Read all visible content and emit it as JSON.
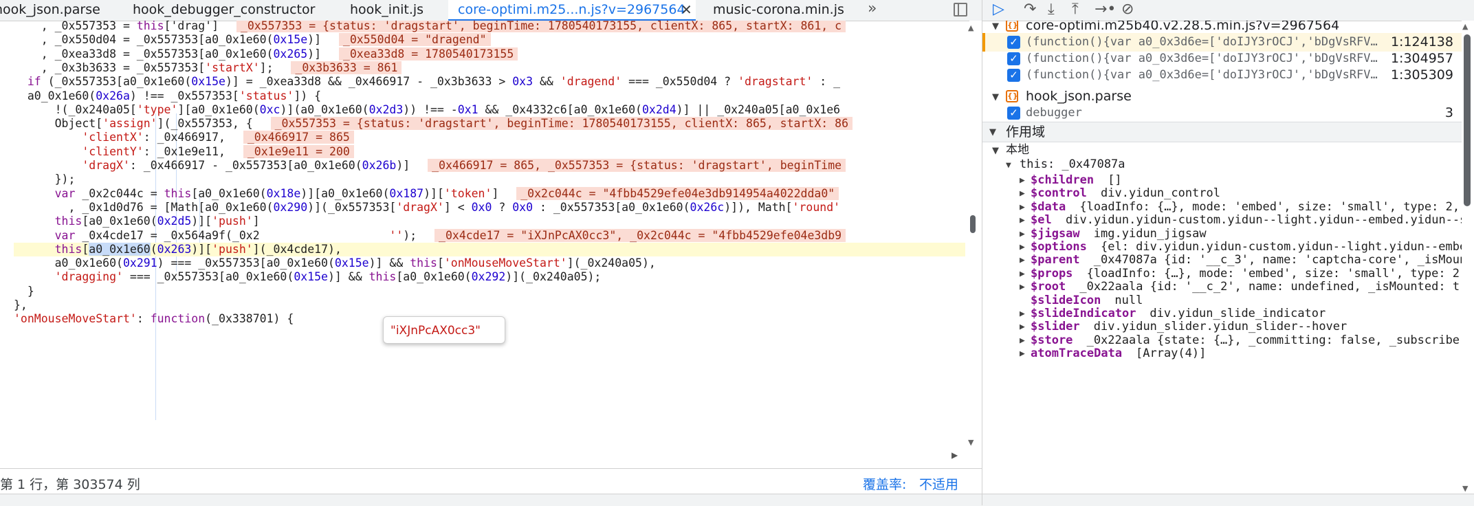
{
  "tabs": [
    {
      "label": "hook_json.parse",
      "active": false
    },
    {
      "label": "hook_debugger_constructor",
      "active": false
    },
    {
      "label": "hook_init.js",
      "active": false
    },
    {
      "label": "core-optimi.m25...n.js?v=2967564",
      "active": true
    },
    {
      "label": "music-corona.min.js",
      "active": false
    }
  ],
  "tab_close_glyph": "✕",
  "tab_more_glyph": "»",
  "code_lines": [
    {
      "segs": [
        [
          "p",
          "    , _0x557353 = "
        ],
        [
          "k",
          "this"
        ],
        [
          "p",
          "['drag']  "
        ],
        [
          "i",
          "_0x557353 = {status: 'dragstart', beginTime: 1780540173155, clientX: 865, startX: 861, c"
        ]
      ]
    },
    {
      "segs": [
        [
          "p",
          "    , _0x550d04 = _0x557353[a0_0x1e60("
        ],
        [
          "n",
          "0x15e"
        ],
        [
          "p",
          ")]  "
        ],
        [
          "i",
          "_0x550d04 = \"dragend\""
        ]
      ]
    },
    {
      "segs": [
        [
          "p",
          "    , _0xea33d8 = _0x557353[a0_0x1e60("
        ],
        [
          "n",
          "0x265"
        ],
        [
          "p",
          ")]  "
        ],
        [
          "i",
          "_0xea33d8 = 1780540173155"
        ]
      ]
    },
    {
      "segs": [
        [
          "p",
          "    , _0x3b3633 = _0x557353["
        ],
        [
          "s",
          "'startX'"
        ],
        [
          "p",
          "];  "
        ],
        [
          "i",
          "_0x3b3633 = 861"
        ]
      ]
    },
    {
      "segs": [
        [
          "p",
          "  "
        ],
        [
          "k",
          "if"
        ],
        [
          "p",
          " (_0x557353[a0_0x1e60("
        ],
        [
          "n",
          "0x15e"
        ],
        [
          "p",
          ")] = _0xea33d8 && _0x466917 - _0x3b3633 > "
        ],
        [
          "n",
          "0x3"
        ],
        [
          "p",
          " && "
        ],
        [
          "s",
          "'dragend'"
        ],
        [
          "p",
          " === _0x550d04 ? "
        ],
        [
          "s",
          "'dragstart'"
        ],
        [
          "p",
          " : _"
        ]
      ]
    },
    {
      "segs": [
        [
          "p",
          "  a0_0x1e60("
        ],
        [
          "n",
          "0x26a"
        ],
        [
          "p",
          ") !== _0x557353["
        ],
        [
          "s",
          "'status'"
        ],
        [
          "p",
          "]) {"
        ]
      ]
    },
    {
      "segs": [
        [
          "p",
          "      !(_0x240a05["
        ],
        [
          "s",
          "'type'"
        ],
        [
          "p",
          "][a0_0x1e60("
        ],
        [
          "n",
          "0xc"
        ],
        [
          "p",
          ")](a0_0x1e60("
        ],
        [
          "n",
          "0x2d3"
        ],
        [
          "p",
          ")) !== -"
        ],
        [
          "n",
          "0x1"
        ],
        [
          "p",
          " && _0x4332c6[a0_0x1e60("
        ],
        [
          "n",
          "0x2d4"
        ],
        [
          "p",
          ")] || _0x240a05[a0_0x1e6"
        ]
      ]
    },
    {
      "segs": [
        [
          "p",
          "      Object["
        ],
        [
          "s",
          "'assign'"
        ],
        [
          "p",
          "](_0x557353, {  "
        ],
        [
          "i",
          "_0x557353 = {status: 'dragstart', beginTime: 1780540173155, clientX: 865, startX: 86"
        ]
      ]
    },
    {
      "segs": [
        [
          "p",
          "          "
        ],
        [
          "s",
          "'clientX'"
        ],
        [
          "p",
          ": _0x466917,  "
        ],
        [
          "i",
          "_0x466917 = 865"
        ]
      ]
    },
    {
      "segs": [
        [
          "p",
          "          "
        ],
        [
          "s",
          "'clientY'"
        ],
        [
          "p",
          ": _0x1e9e11,  "
        ],
        [
          "i",
          "_0x1e9e11 = 200"
        ]
      ]
    },
    {
      "segs": [
        [
          "p",
          "          "
        ],
        [
          "s",
          "'dragX'"
        ],
        [
          "p",
          ": _0x466917 - _0x557353[a0_0x1e60("
        ],
        [
          "n",
          "0x26b"
        ],
        [
          "p",
          ")]  "
        ],
        [
          "i",
          "_0x466917 = 865, _0x557353 = {status: 'dragstart', beginTime"
        ]
      ]
    },
    {
      "segs": [
        [
          "p",
          "      });"
        ]
      ]
    },
    {
      "segs": [
        [
          "p",
          "      "
        ],
        [
          "k",
          "var"
        ],
        [
          "p",
          " _0x2c044c = "
        ],
        [
          "k",
          "this"
        ],
        [
          "p",
          "[a0_0x1e60("
        ],
        [
          "n",
          "0x18e"
        ],
        [
          "p",
          ")][a0_0x1e60("
        ],
        [
          "n",
          "0x187"
        ],
        [
          "p",
          ")]["
        ],
        [
          "s",
          "'token'"
        ],
        [
          "p",
          "]  "
        ],
        [
          "i",
          "_0x2c044c = \"4fbb4529efe04e3db914954a4022dda0\""
        ]
      ]
    },
    {
      "segs": [
        [
          "p",
          "        , _0x1d0d76 = [Math[a0_0x1e60("
        ],
        [
          "n",
          "0x290"
        ],
        [
          "p",
          ")](_0x557353["
        ],
        [
          "s",
          "'dragX'"
        ],
        [
          "p",
          "] < "
        ],
        [
          "n",
          "0x0"
        ],
        [
          "p",
          " ? "
        ],
        [
          "n",
          "0x0"
        ],
        [
          "p",
          " : _0x557353[a0_0x1e60("
        ],
        [
          "n",
          "0x26c"
        ],
        [
          "p",
          ")]), Math["
        ],
        [
          "s",
          "'round'"
        ]
      ]
    },
    {
      "segs": [
        [
          "p",
          "      "
        ],
        [
          "k",
          "this"
        ],
        [
          "p",
          "[a0_0x1e60("
        ],
        [
          "n",
          "0x2d5"
        ],
        [
          "p",
          ")]["
        ],
        [
          "s",
          "'push'"
        ],
        [
          "p",
          "]"
        ]
      ]
    },
    {
      "segs": [
        [
          "p",
          "      "
        ],
        [
          "k",
          "var"
        ],
        [
          "p",
          " _0x4cde17 = _0x564a9f(_0x2                   "
        ],
        [
          "s",
          "''"
        ],
        [
          "p",
          ");  "
        ],
        [
          "i",
          "_0x4cde17 = \"iXJnPcAX0cc3\", _0x2c044c = \"4fbb4529efe04e3db9"
        ]
      ]
    },
    {
      "segs": [
        [
          "p",
          "      "
        ],
        [
          "k",
          "this"
        ],
        [
          "p",
          "["
        ],
        [
          "sel",
          "a0_0x1e60"
        ],
        [
          "p",
          "("
        ],
        [
          "n",
          "0x263"
        ],
        [
          "p",
          ")]["
        ],
        [
          "s",
          "'push'"
        ],
        [
          "p",
          "](_0x4cde17),"
        ]
      ]
    },
    {
      "segs": [
        [
          "p",
          "      a0_0x1e60("
        ],
        [
          "n",
          "0x291"
        ],
        [
          "p",
          ") === _0x557353[a0_0x1e60("
        ],
        [
          "n",
          "0x15e"
        ],
        [
          "p",
          ")] && "
        ],
        [
          "k",
          "this"
        ],
        [
          "p",
          "["
        ],
        [
          "s",
          "'onMouseMoveStart'"
        ],
        [
          "p",
          "](_0x240a05),"
        ]
      ]
    },
    {
      "segs": [
        [
          "p",
          "      "
        ],
        [
          "s",
          "'dragging'"
        ],
        [
          "p",
          " === _0x557353[a0_0x1e60("
        ],
        [
          "n",
          "0x15e"
        ],
        [
          "p",
          ")] && "
        ],
        [
          "k",
          "this"
        ],
        [
          "p",
          "[a0_0x1e60("
        ],
        [
          "n",
          "0x292"
        ],
        [
          "p",
          ")](_0x240a05);"
        ]
      ]
    },
    {
      "segs": [
        [
          "p",
          "  }"
        ]
      ]
    },
    {
      "segs": [
        [
          "p",
          "},"
        ]
      ]
    },
    {
      "segs": [
        [
          "s",
          "'onMouseMoveStart'"
        ],
        [
          "p",
          ": "
        ],
        [
          "k",
          "function"
        ],
        [
          "p",
          "(_0x338701) {"
        ]
      ]
    },
    {
      "segs": [
        [
          "p",
          ""
        ]
      ]
    }
  ],
  "hover_popup": "\"iXJnPcAX0cc3\"",
  "status": {
    "position": "第 1 行，第 303574 列",
    "coverage_label": "覆盖率:",
    "coverage_value": "不适用"
  },
  "breakpoints": {
    "file1": "core-optimi.m25b40.v2.28.5.min.js?v=2967564",
    "file1_items": [
      {
        "code": "(function(){var a0_0x3d6e=['doIJY3rOCJ','bDgVsRFV…",
        "loc": "1:124138",
        "active": true
      },
      {
        "code": "(function(){var a0_0x3d6e=['doIJY3rOCJ','bDgVsRFV…",
        "loc": "1:304957",
        "active": false
      },
      {
        "code": "(function(){var a0_0x3d6e=['doIJY3rOCJ','bDgVsRFV…",
        "loc": "1:305309",
        "active": false
      }
    ],
    "file2": "hook_json.parse",
    "file2_items": [
      {
        "code": "debugger",
        "loc": "3",
        "active": false
      }
    ]
  },
  "scope": {
    "section_title": "作用域",
    "local_label": "本地",
    "this_label": "this: _0x47087a",
    "props": [
      {
        "name": "$children",
        "value": "[]",
        "expandable": true
      },
      {
        "name": "$control",
        "value": "div.yidun_control",
        "expandable": true
      },
      {
        "name": "$data",
        "value": "{loadInfo: {…}, mode: 'embed', size: 'small', type: 2,",
        "expandable": true
      },
      {
        "name": "$el",
        "value": "div.yidun.yidun-custom.yidun--light.yidun--embed.yidun--si",
        "expandable": true
      },
      {
        "name": "$jigsaw",
        "value": "img.yidun_jigsaw",
        "expandable": true
      },
      {
        "name": "$options",
        "value": "{el: div.yidun.yidun-custom.yidun--light.yidun--embed",
        "expandable": true
      },
      {
        "name": "$parent",
        "value": "_0x47087a  {id: '__c_3', name: 'captcha-core', _isMoun",
        "expandable": true
      },
      {
        "name": "$props",
        "value": "{loadInfo: {…}, mode: 'embed', size: 'small', type: 2,",
        "expandable": true
      },
      {
        "name": "$root",
        "value": "_0x22aala  {id: '__c_2', name: undefined, _isMounted: tr",
        "expandable": true
      },
      {
        "name": "$slideIcon",
        "value": "null",
        "expandable": false
      },
      {
        "name": "$slideIndicator",
        "value": "div.yidun_slide_indicator",
        "expandable": true
      },
      {
        "name": "$slider",
        "value": "div.yidun_slider.yidun_slider--hover",
        "expandable": true
      },
      {
        "name": "$store",
        "value": "_0x22aala  {state: {…}, _committing: false, _subscribe",
        "expandable": true
      },
      {
        "name": "atomTraceData",
        "value": "[Array(4)]",
        "expandable": true
      }
    ]
  },
  "colors": {
    "accent": "#1a73e8",
    "string": "#c41a16",
    "number": "#1c00cf",
    "keyword": "#881391",
    "inline_value_bg": "#fbdcd4",
    "highlight_line_bg": "#fffbd2"
  },
  "icons": [
    "resume-icon",
    "step-over-icon",
    "step-into-icon",
    "step-out-icon",
    "step-icon",
    "deactivate-breakpoints-icon"
  ]
}
